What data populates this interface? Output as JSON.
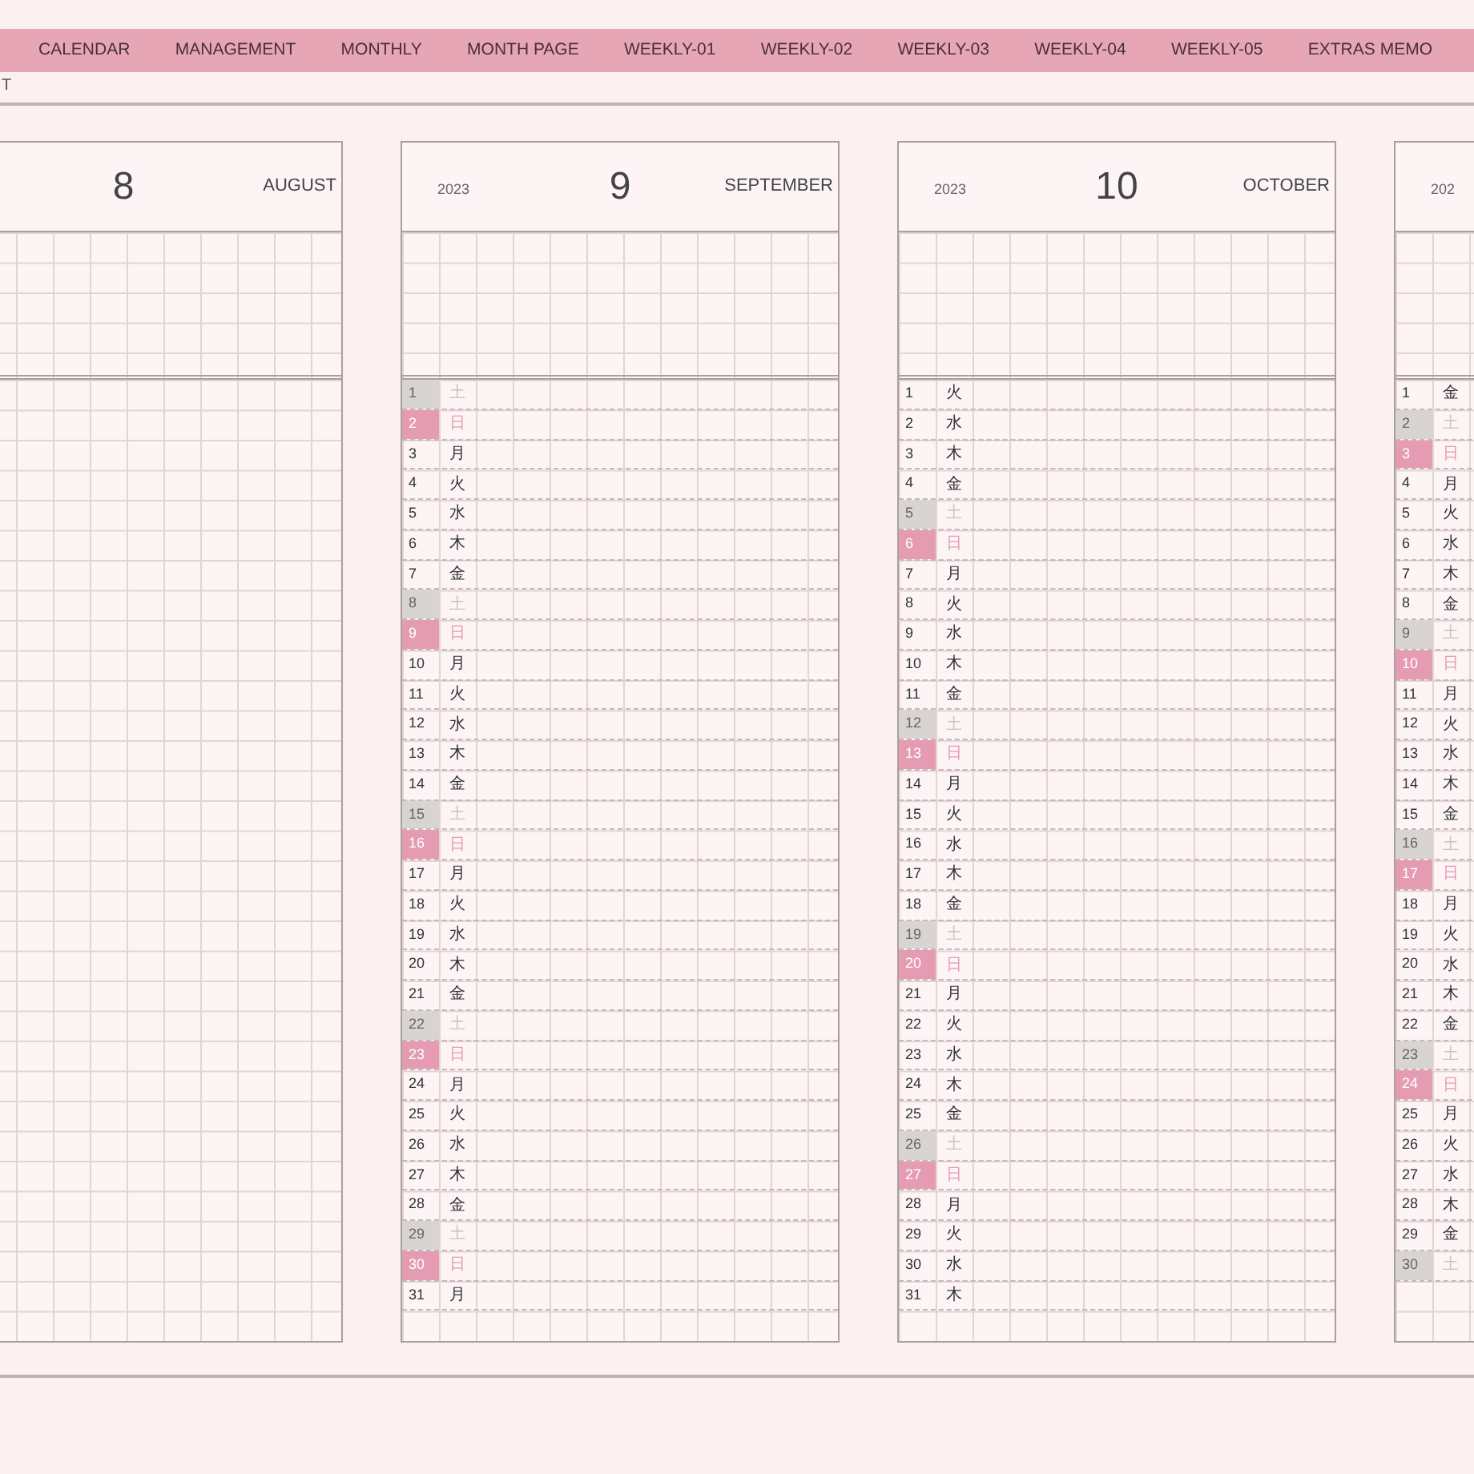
{
  "nav": {
    "tabs": [
      "CALENDAR",
      "MANAGEMENT",
      "MONTHLY",
      "MONTH PAGE",
      "WEEKLY-01",
      "WEEKLY-02",
      "WEEKLY-03",
      "WEEKLY-04",
      "WEEKLY-05",
      "EXTRAS MEMO"
    ]
  },
  "page_label": "T",
  "months": [
    {
      "number": "8",
      "name": "AUGUST"
    },
    {
      "year": "2023",
      "number": "9",
      "name": "SEPTEMBER",
      "days": [
        {
          "day": "1",
          "weekday": "土",
          "kind": "saturday"
        },
        {
          "day": "2",
          "weekday": "日",
          "kind": "sunday"
        },
        {
          "day": "3",
          "weekday": "月",
          "kind": "weekday"
        },
        {
          "day": "4",
          "weekday": "火",
          "kind": "weekday"
        },
        {
          "day": "5",
          "weekday": "水",
          "kind": "weekday"
        },
        {
          "day": "6",
          "weekday": "木",
          "kind": "weekday"
        },
        {
          "day": "7",
          "weekday": "金",
          "kind": "weekday"
        },
        {
          "day": "8",
          "weekday": "土",
          "kind": "saturday"
        },
        {
          "day": "9",
          "weekday": "日",
          "kind": "sunday"
        },
        {
          "day": "10",
          "weekday": "月",
          "kind": "weekday"
        },
        {
          "day": "11",
          "weekday": "火",
          "kind": "weekday"
        },
        {
          "day": "12",
          "weekday": "水",
          "kind": "weekday"
        },
        {
          "day": "13",
          "weekday": "木",
          "kind": "weekday"
        },
        {
          "day": "14",
          "weekday": "金",
          "kind": "weekday"
        },
        {
          "day": "15",
          "weekday": "土",
          "kind": "saturday"
        },
        {
          "day": "16",
          "weekday": "日",
          "kind": "sunday"
        },
        {
          "day": "17",
          "weekday": "月",
          "kind": "weekday"
        },
        {
          "day": "18",
          "weekday": "火",
          "kind": "weekday"
        },
        {
          "day": "19",
          "weekday": "水",
          "kind": "weekday"
        },
        {
          "day": "20",
          "weekday": "木",
          "kind": "weekday"
        },
        {
          "day": "21",
          "weekday": "金",
          "kind": "weekday"
        },
        {
          "day": "22",
          "weekday": "土",
          "kind": "saturday"
        },
        {
          "day": "23",
          "weekday": "日",
          "kind": "sunday"
        },
        {
          "day": "24",
          "weekday": "月",
          "kind": "weekday"
        },
        {
          "day": "25",
          "weekday": "火",
          "kind": "weekday"
        },
        {
          "day": "26",
          "weekday": "水",
          "kind": "weekday"
        },
        {
          "day": "27",
          "weekday": "木",
          "kind": "weekday"
        },
        {
          "day": "28",
          "weekday": "金",
          "kind": "weekday"
        },
        {
          "day": "29",
          "weekday": "土",
          "kind": "saturday"
        },
        {
          "day": "30",
          "weekday": "日",
          "kind": "sunday"
        },
        {
          "day": "31",
          "weekday": "月",
          "kind": "weekday"
        }
      ]
    },
    {
      "year": "2023",
      "number": "10",
      "name": "OCTOBER",
      "days": [
        {
          "day": "1",
          "weekday": "火",
          "kind": "weekday"
        },
        {
          "day": "2",
          "weekday": "水",
          "kind": "weekday"
        },
        {
          "day": "3",
          "weekday": "木",
          "kind": "weekday"
        },
        {
          "day": "4",
          "weekday": "金",
          "kind": "weekday"
        },
        {
          "day": "5",
          "weekday": "土",
          "kind": "saturday"
        },
        {
          "day": "6",
          "weekday": "日",
          "kind": "sunday"
        },
        {
          "day": "7",
          "weekday": "月",
          "kind": "weekday"
        },
        {
          "day": "8",
          "weekday": "火",
          "kind": "weekday"
        },
        {
          "day": "9",
          "weekday": "水",
          "kind": "weekday"
        },
        {
          "day": "10",
          "weekday": "木",
          "kind": "weekday"
        },
        {
          "day": "11",
          "weekday": "金",
          "kind": "weekday"
        },
        {
          "day": "12",
          "weekday": "土",
          "kind": "saturday"
        },
        {
          "day": "13",
          "weekday": "日",
          "kind": "sunday"
        },
        {
          "day": "14",
          "weekday": "月",
          "kind": "weekday"
        },
        {
          "day": "15",
          "weekday": "火",
          "kind": "weekday"
        },
        {
          "day": "16",
          "weekday": "水",
          "kind": "weekday"
        },
        {
          "day": "17",
          "weekday": "木",
          "kind": "weekday"
        },
        {
          "day": "18",
          "weekday": "金",
          "kind": "weekday"
        },
        {
          "day": "19",
          "weekday": "土",
          "kind": "saturday"
        },
        {
          "day": "20",
          "weekday": "日",
          "kind": "sunday"
        },
        {
          "day": "21",
          "weekday": "月",
          "kind": "weekday"
        },
        {
          "day": "22",
          "weekday": "火",
          "kind": "weekday"
        },
        {
          "day": "23",
          "weekday": "水",
          "kind": "weekday"
        },
        {
          "day": "24",
          "weekday": "木",
          "kind": "weekday"
        },
        {
          "day": "25",
          "weekday": "金",
          "kind": "weekday"
        },
        {
          "day": "26",
          "weekday": "土",
          "kind": "saturday"
        },
        {
          "day": "27",
          "weekday": "日",
          "kind": "sunday"
        },
        {
          "day": "28",
          "weekday": "月",
          "kind": "weekday"
        },
        {
          "day": "29",
          "weekday": "火",
          "kind": "weekday"
        },
        {
          "day": "30",
          "weekday": "水",
          "kind": "weekday"
        },
        {
          "day": "31",
          "weekday": "木",
          "kind": "weekday"
        }
      ]
    },
    {
      "year": "202",
      "days": [
        {
          "day": "1",
          "weekday": "金",
          "kind": "weekday"
        },
        {
          "day": "2",
          "weekday": "土",
          "kind": "saturday"
        },
        {
          "day": "3",
          "weekday": "日",
          "kind": "sunday"
        },
        {
          "day": "4",
          "weekday": "月",
          "kind": "weekday"
        },
        {
          "day": "5",
          "weekday": "火",
          "kind": "weekday"
        },
        {
          "day": "6",
          "weekday": "水",
          "kind": "weekday"
        },
        {
          "day": "7",
          "weekday": "木",
          "kind": "weekday"
        },
        {
          "day": "8",
          "weekday": "金",
          "kind": "weekday"
        },
        {
          "day": "9",
          "weekday": "土",
          "kind": "saturday"
        },
        {
          "day": "10",
          "weekday": "日",
          "kind": "sunday"
        },
        {
          "day": "11",
          "weekday": "月",
          "kind": "weekday"
        },
        {
          "day": "12",
          "weekday": "火",
          "kind": "weekday"
        },
        {
          "day": "13",
          "weekday": "水",
          "kind": "weekday"
        },
        {
          "day": "14",
          "weekday": "木",
          "kind": "weekday"
        },
        {
          "day": "15",
          "weekday": "金",
          "kind": "weekday"
        },
        {
          "day": "16",
          "weekday": "土",
          "kind": "saturday"
        },
        {
          "day": "17",
          "weekday": "日",
          "kind": "sunday"
        },
        {
          "day": "18",
          "weekday": "月",
          "kind": "weekday"
        },
        {
          "day": "19",
          "weekday": "火",
          "kind": "weekday"
        },
        {
          "day": "20",
          "weekday": "水",
          "kind": "weekday"
        },
        {
          "day": "21",
          "weekday": "木",
          "kind": "weekday"
        },
        {
          "day": "22",
          "weekday": "金",
          "kind": "weekday"
        },
        {
          "day": "23",
          "weekday": "土",
          "kind": "saturday"
        },
        {
          "day": "24",
          "weekday": "日",
          "kind": "sunday"
        },
        {
          "day": "25",
          "weekday": "月",
          "kind": "weekday"
        },
        {
          "day": "26",
          "weekday": "火",
          "kind": "weekday"
        },
        {
          "day": "27",
          "weekday": "水",
          "kind": "weekday"
        },
        {
          "day": "28",
          "weekday": "木",
          "kind": "weekday"
        },
        {
          "day": "29",
          "weekday": "金",
          "kind": "weekday"
        },
        {
          "day": "30",
          "weekday": "土",
          "kind": "saturday"
        }
      ]
    }
  ]
}
